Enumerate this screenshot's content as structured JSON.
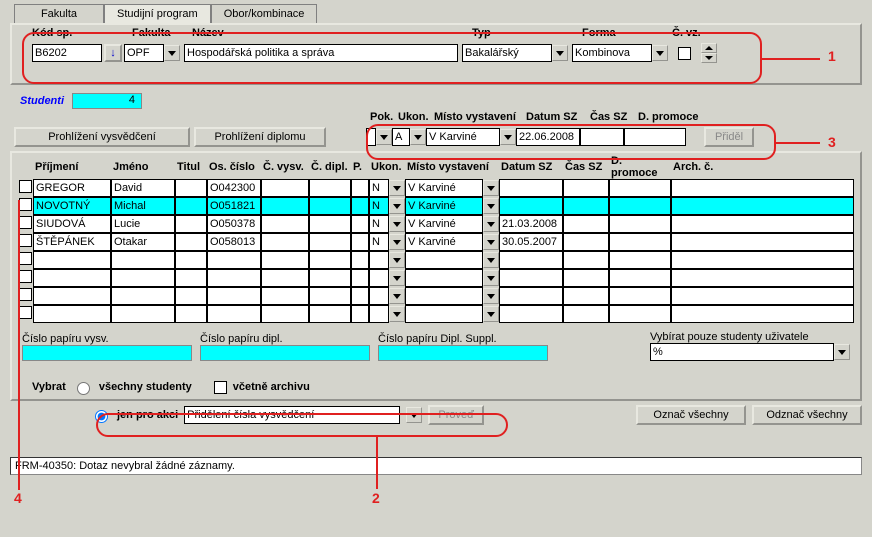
{
  "tabs": {
    "fakulta": "Fakulta",
    "program": "Studijní program",
    "obor": "Obor/kombinace"
  },
  "top": {
    "labels": {
      "kod": "Kód sp.",
      "fakulta": "Fakulta",
      "nazev": "Název",
      "typ": "Typ",
      "forma": "Forma",
      "cvz": "Č. vz."
    },
    "kod": "B6202",
    "fakulta": "OPF",
    "nazev": "Hospodářská politika a správa",
    "typ": "Bakalářský",
    "forma": "Kombinova"
  },
  "students_label": "Studenti",
  "students_count": "4",
  "btn_prohlizeni_vysv": "Prohlížení vysvědčení",
  "btn_prohlizeni_dipl": "Prohlížení diplomu",
  "btn_pridel": "Přiděl",
  "filter": {
    "labels": {
      "pok": "Pok.",
      "ukon": "Ukon.",
      "misto": "Místo vystavení",
      "datum": "Datum SZ",
      "cas": "Čas SZ",
      "promoce": "D. promoce"
    },
    "ukon": "A",
    "misto": "V Karviné",
    "datum": "22.06.2008"
  },
  "cols": {
    "prijmeni": "Příjmení",
    "jmeno": "Jméno",
    "titul": "Titul",
    "oscislo": "Os. číslo",
    "cvysv": "Č. vysv.",
    "cdipl": "Č. dipl.",
    "p": "P.",
    "ukon": "Ukon.",
    "misto": "Místo vystavení",
    "datum": "Datum SZ",
    "cas": "Čas SZ",
    "promoce": "D. promoce",
    "arch": "Arch. č."
  },
  "rows": [
    {
      "sel": false,
      "prijmeni": "GREGOR",
      "jmeno": "David",
      "titul": "",
      "oscislo": "O042300",
      "cvysv": "",
      "cdipl": "",
      "p": "",
      "ukon": "N",
      "misto": "V Karviné",
      "datum": "",
      "cas": "",
      "promoce": "",
      "arch": "",
      "cyan": false
    },
    {
      "sel": false,
      "prijmeni": "NOVOTNÝ",
      "jmeno": "Michal",
      "titul": "",
      "oscislo": "O051821",
      "cvysv": "",
      "cdipl": "",
      "p": "",
      "ukon": "N",
      "misto": "V Karviné",
      "datum": "",
      "cas": "",
      "promoce": "",
      "arch": "",
      "cyan": true
    },
    {
      "sel": false,
      "prijmeni": "SIUDOVÁ",
      "jmeno": "Lucie",
      "titul": "",
      "oscislo": "O050378",
      "cvysv": "",
      "cdipl": "",
      "p": "",
      "ukon": "N",
      "misto": "V Karviné",
      "datum": "21.03.2008",
      "cas": "",
      "promoce": "",
      "arch": "",
      "cyan": false
    },
    {
      "sel": false,
      "prijmeni": "ŠTĚPÁNEK",
      "jmeno": "Otakar",
      "titul": "",
      "oscislo": "O058013",
      "cvysv": "",
      "cdipl": "",
      "p": "",
      "ukon": "N",
      "misto": "V Karviné",
      "datum": "30.05.2007",
      "cas": "",
      "promoce": "",
      "arch": "",
      "cyan": false
    }
  ],
  "paper": {
    "vysv_lbl": "Číslo papíru vysv.",
    "dipl_lbl": "Číslo papíru dipl.",
    "suppl_lbl": "Číslo papíru Dipl. Suppl.",
    "vybrat_lbl": "Vybírat pouze studenty uživatele",
    "pct": "%"
  },
  "select_row": {
    "vybrat": "Vybrat",
    "all": "všechny studenty",
    "archive": "včetně archivu",
    "jen": "jen pro akci",
    "akce": "Přidělení čísla vysvědčení",
    "proved": "Proveď",
    "oznac": "Označ všechny",
    "odznac": "Odznač všechny"
  },
  "status": "FRM-40350: Dotaz nevybral žádné záznamy.",
  "annot": {
    "1": "1",
    "2": "2",
    "3": "3",
    "4": "4"
  }
}
